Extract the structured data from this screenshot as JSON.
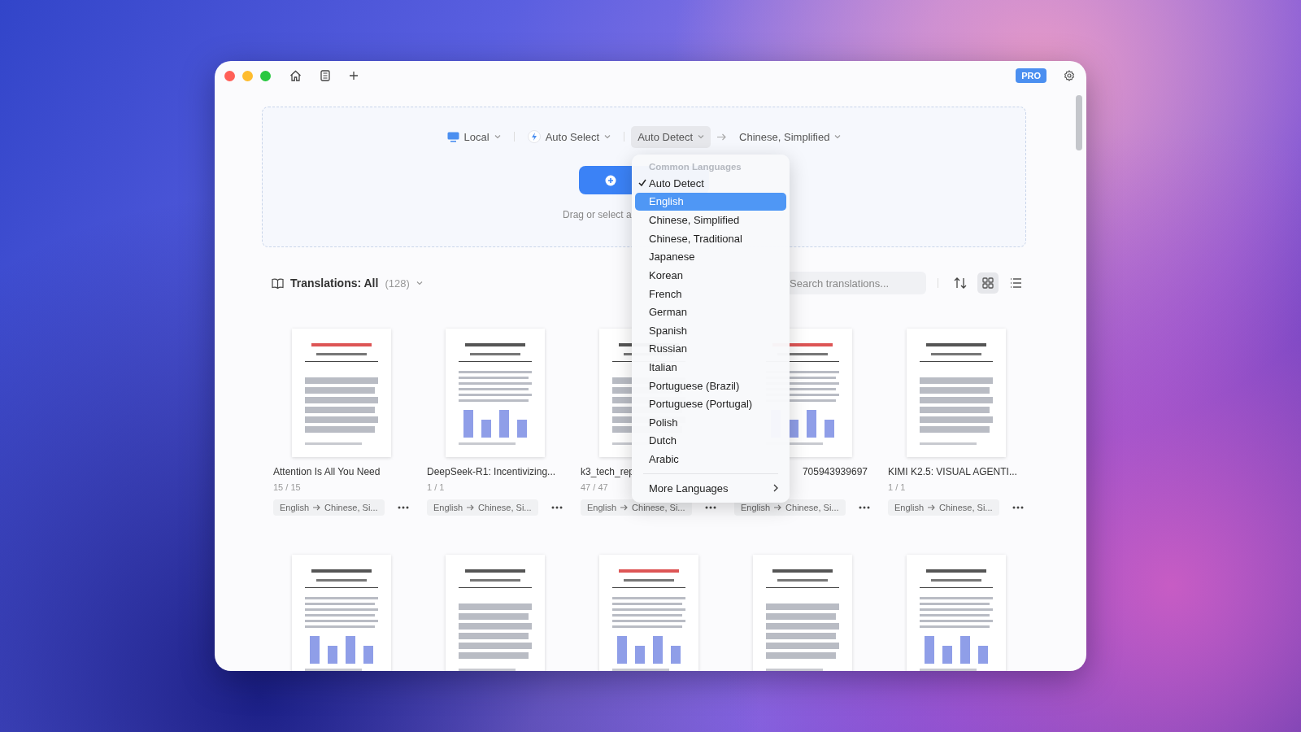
{
  "titlebar": {
    "badge": "PRO"
  },
  "drop_zone": {
    "engine": "Local",
    "model": "Auto Select",
    "source_language": "Auto Detect",
    "target_language": "Chinese, Simplified",
    "hint": "Drag or select a"
  },
  "language_menu": {
    "section": "Common Languages",
    "items": [
      {
        "label": "Auto Detect",
        "checked": true,
        "selected": false
      },
      {
        "label": "English",
        "checked": false,
        "selected": true
      },
      {
        "label": "Chinese, Simplified",
        "checked": false,
        "selected": false
      },
      {
        "label": "Chinese, Traditional",
        "checked": false,
        "selected": false
      },
      {
        "label": "Japanese",
        "checked": false,
        "selected": false
      },
      {
        "label": "Korean",
        "checked": false,
        "selected": false
      },
      {
        "label": "French",
        "checked": false,
        "selected": false
      },
      {
        "label": "German",
        "checked": false,
        "selected": false
      },
      {
        "label": "Spanish",
        "checked": false,
        "selected": false
      },
      {
        "label": "Russian",
        "checked": false,
        "selected": false
      },
      {
        "label": "Italian",
        "checked": false,
        "selected": false
      },
      {
        "label": "Portuguese (Brazil)",
        "checked": false,
        "selected": false
      },
      {
        "label": "Portuguese (Portugal)",
        "checked": false,
        "selected": false
      },
      {
        "label": "Polish",
        "checked": false,
        "selected": false
      },
      {
        "label": "Dutch",
        "checked": false,
        "selected": false
      },
      {
        "label": "Arabic",
        "checked": false,
        "selected": false
      }
    ],
    "more": "More Languages"
  },
  "translations": {
    "title": "Translations: All",
    "count": "(128)",
    "search_placeholder": "Search translations...",
    "views": [
      {
        "kind": "grid",
        "selected": true
      },
      {
        "kind": "list",
        "selected": false
      }
    ]
  },
  "documents": [
    {
      "title": "Attention Is All You Need",
      "pages": "15 / 15",
      "from": "English",
      "to": "Chinese, Si..."
    },
    {
      "title": "DeepSeek-R1: Incentivizing...",
      "pages": "1 / 1",
      "from": "English",
      "to": "Chinese, Si..."
    },
    {
      "title": "k3_tech_rep",
      "pages": "47 / 47",
      "from": "English",
      "to": "Chinese, Si..."
    },
    {
      "title": "705943939697",
      "kind": "tail",
      "from": "English",
      "to": "Chinese, Si..."
    },
    {
      "title": "KIMI K2.5: VISUAL AGENTI...",
      "pages": "1 / 1",
      "from": "English",
      "to": "Chinese, Si..."
    }
  ]
}
